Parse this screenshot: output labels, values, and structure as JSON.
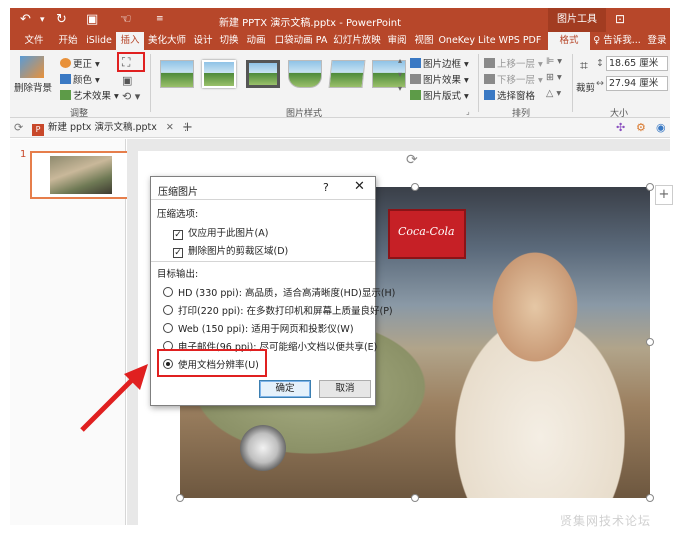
{
  "titlebar": {
    "title": "新建 PPTX 演示文稿.pptx - PowerPoint",
    "context_tab": "图片工具",
    "colors": {
      "brand": "#b7472a"
    }
  },
  "tabs": [
    "文件",
    "开始",
    "iSlide",
    "插入",
    "美化大师",
    "设计",
    "切换",
    "动画",
    "口袋动画 PA",
    "幻灯片放映",
    "审阅",
    "视图",
    "OneKey Lite",
    "WPS PDF",
    "格式"
  ],
  "tell_me": "♀ 告诉我...",
  "login": "登录",
  "ribbon": {
    "remove_bg": "删除背景",
    "corrections": "更正",
    "color": "颜色",
    "artistic": "艺术效果",
    "group_adjust": "调整",
    "group_styles": "图片样式",
    "border": "图片边框",
    "effects": "图片效果",
    "layout": "图片版式",
    "bring_forward": "上移一层",
    "send_backward": "下移一层",
    "selection_pane": "选择窗格",
    "group_arrange": "排列",
    "crop": "裁剪",
    "height": "18.65 厘米",
    "width": "27.94 厘米",
    "group_size": "大小"
  },
  "doc_tab": {
    "badge": "P",
    "name": "新建 pptx 演示文稿.pptx"
  },
  "slides": [
    {
      "number": "1"
    }
  ],
  "dialog": {
    "title": "压缩图片",
    "help": "?",
    "close": "✕",
    "section_compress": "压缩选项:",
    "options": [
      {
        "label": "仅应用于此图片(A)",
        "checked": true
      },
      {
        "label": "删除图片的剪裁区域(D)",
        "checked": true
      }
    ],
    "section_output": "目标输出:",
    "resolutions": [
      {
        "label": "HD (330 ppi): 高品质，适合高清晰度(HD)显示(H)",
        "selected": false
      },
      {
        "label": "打印(220 ppi): 在多数打印机和屏幕上质量良好(P)",
        "selected": false
      },
      {
        "label": "Web (150 ppi): 适用于网页和投影仪(W)",
        "selected": false
      },
      {
        "label": "电子邮件(96 ppi): 尽可能缩小文档以便共享(E)",
        "selected": false
      },
      {
        "label": "使用文档分辨率(U)",
        "selected": true
      }
    ],
    "ok": "确定",
    "cancel": "取消"
  },
  "photo": {
    "cooler_text": "Coca-Cola"
  },
  "watermark": "贤集网技术论坛"
}
